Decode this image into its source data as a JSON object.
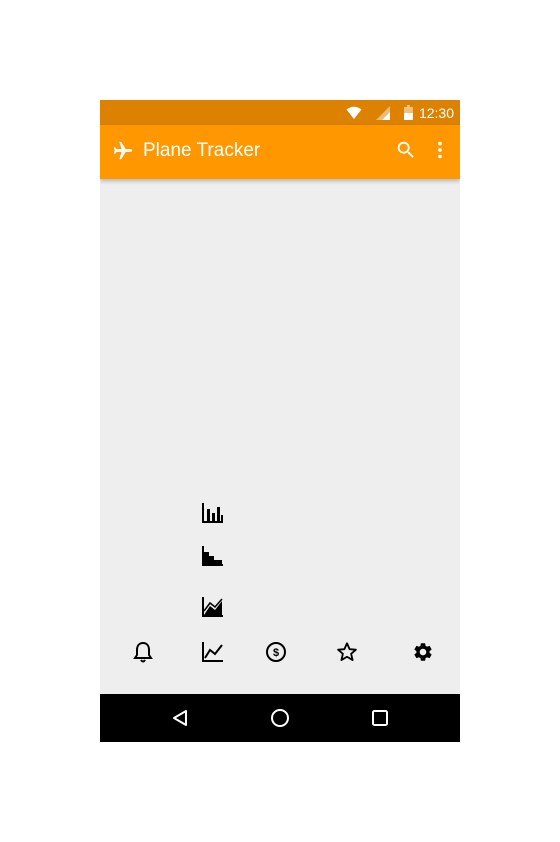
{
  "status_bar": {
    "time": "12:30",
    "icons": [
      "wifi-icon",
      "cell-signal-icon",
      "battery-icon"
    ],
    "color": "#dd8200"
  },
  "app_bar": {
    "title": "Plane Tracker",
    "leading_icon": "airplane-icon",
    "actions": [
      "search-icon",
      "more-vert-icon"
    ],
    "color": "#ff9800"
  },
  "content": {
    "chart_icons": [
      "bar-chart-icon",
      "stepped-chart-icon",
      "area-chart-icon"
    ],
    "background": "#eeeeee"
  },
  "bottom_nav": {
    "items": [
      "bell-icon",
      "line-chart-icon",
      "dollar-circle-icon",
      "star-icon",
      "gear-icon"
    ]
  },
  "system_nav": {
    "buttons": [
      "back-icon",
      "home-icon",
      "recents-icon"
    ]
  }
}
